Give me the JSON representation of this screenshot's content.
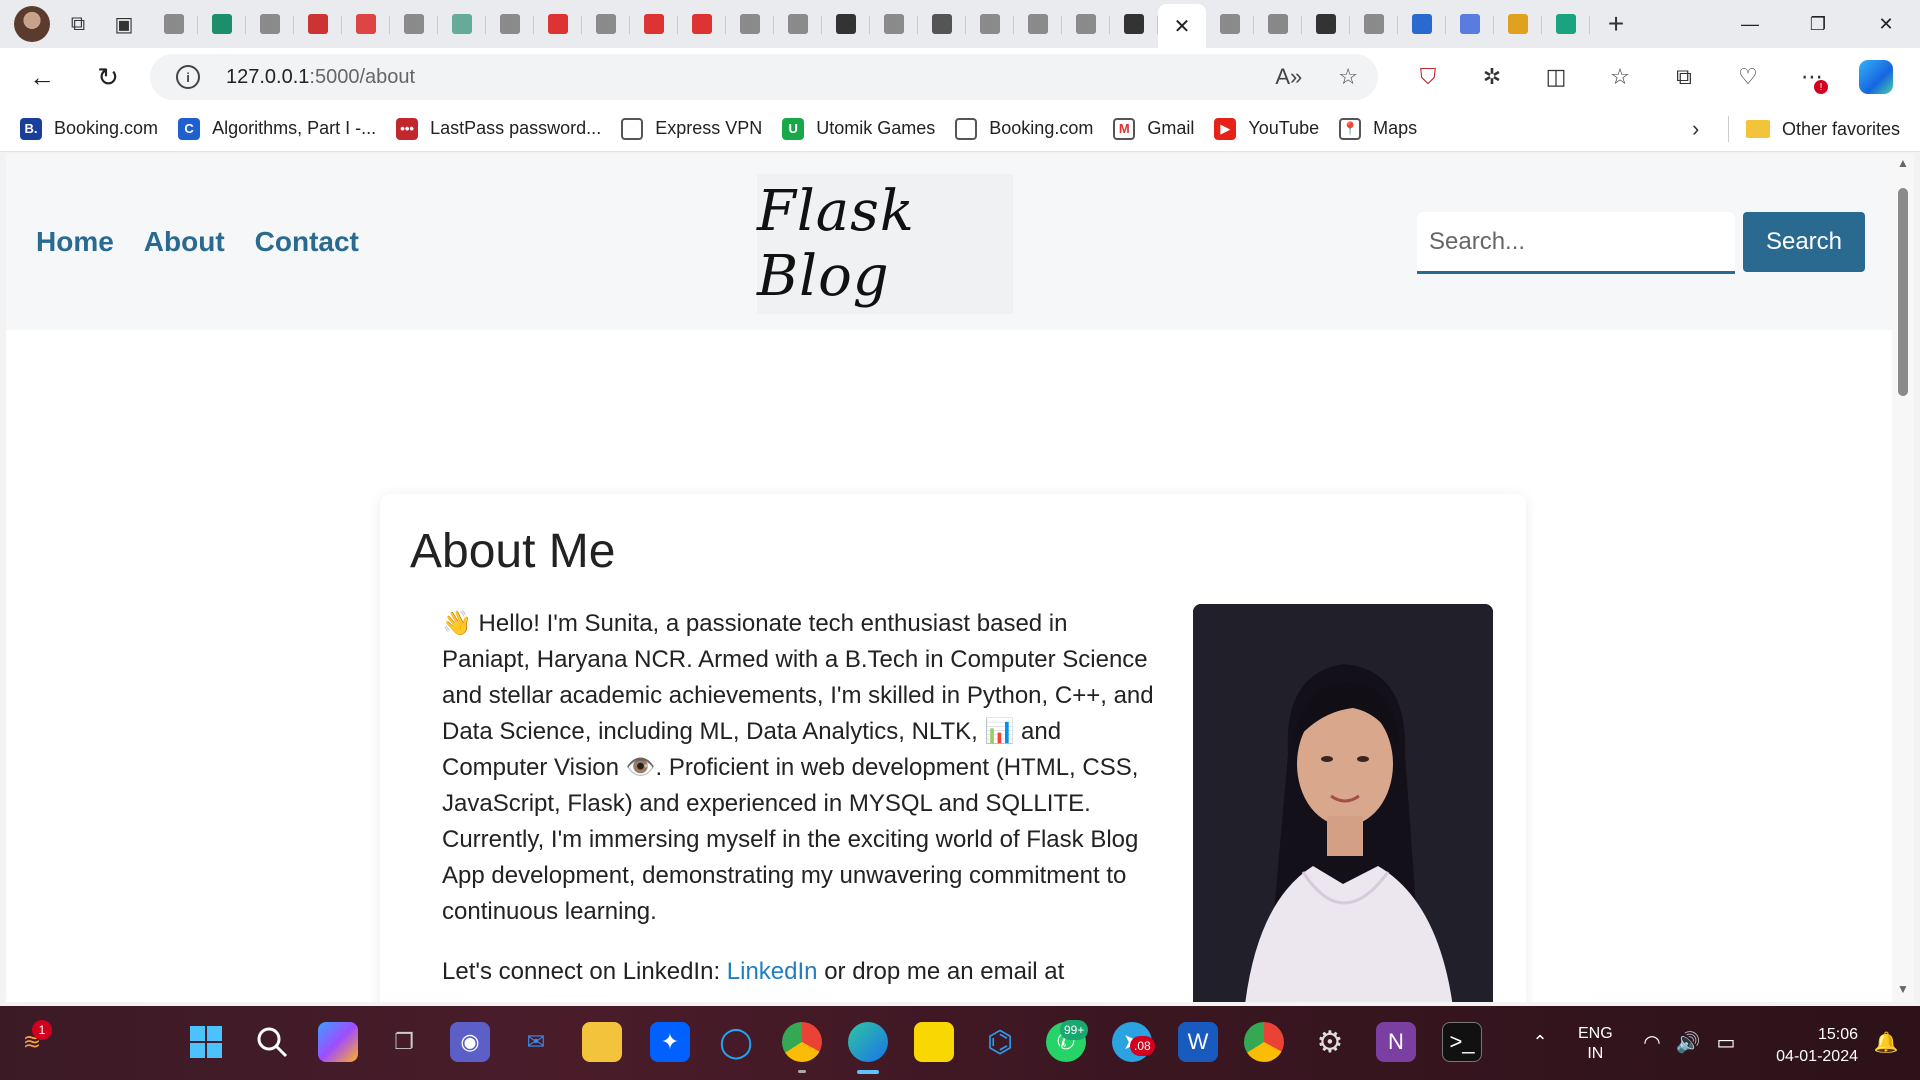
{
  "browser": {
    "tabs": [
      {
        "icon": "search-icon",
        "color": "#8a8a8a"
      },
      {
        "icon": "calendar-icon",
        "color": "#1b8f6a"
      },
      {
        "icon": "page-icon",
        "color": "#8a8a8a"
      },
      {
        "icon": "pdf-icon",
        "color": "#c33"
      },
      {
        "icon": "gmail-icon",
        "color": "#d44"
      },
      {
        "icon": "search-icon",
        "color": "#8a8a8a"
      },
      {
        "icon": "image-icon",
        "color": "#6a9"
      },
      {
        "icon": "page-icon",
        "color": "#8a8a8a"
      },
      {
        "icon": "shield-icon",
        "color": "#d33"
      },
      {
        "icon": "doc-icon",
        "color": "#8a8a8a"
      },
      {
        "icon": "shield-icon",
        "color": "#d33"
      },
      {
        "icon": "shield-icon",
        "color": "#d33"
      },
      {
        "icon": "doc-icon",
        "color": "#8a8a8a"
      },
      {
        "icon": "search-icon",
        "color": "#8a8a8a"
      },
      {
        "icon": "github-icon",
        "color": "#333"
      },
      {
        "icon": "doc-icon",
        "color": "#8a8a8a"
      },
      {
        "icon": "terminal-icon",
        "color": "#555"
      },
      {
        "icon": "search-icon",
        "color": "#8a8a8a"
      },
      {
        "icon": "page-icon",
        "color": "#8a8a8a"
      },
      {
        "icon": "search-icon",
        "color": "#8a8a8a"
      },
      {
        "icon": "github-icon",
        "color": "#333"
      },
      {
        "icon": "close-icon",
        "color": "#222",
        "active": true
      },
      {
        "icon": "search-icon",
        "color": "#8a8a8a"
      },
      {
        "icon": "dns-icon",
        "color": "#888"
      },
      {
        "icon": "page-icon",
        "color": "#333"
      },
      {
        "icon": "search-icon",
        "color": "#8a8a8a"
      },
      {
        "icon": "search-icon",
        "color": "#2a6ad0"
      },
      {
        "icon": "doc-icon",
        "color": "#5a7be0"
      },
      {
        "icon": "star-icon",
        "color": "#e0a020"
      },
      {
        "icon": "chatgpt-icon",
        "color": "#19a37f"
      }
    ],
    "close_glyph": "✕",
    "new_tab_glyph": "+",
    "url_host": "127.0.0.1",
    "url_path": ":5000/about",
    "info_glyph": "i",
    "favorites": [
      {
        "label": "Booking.com",
        "icon": "booking-icon",
        "color": "#1a3f9a",
        "glyph": "B."
      },
      {
        "label": "Algorithms, Part I -...",
        "icon": "coursera-icon",
        "color": "#1f5fd0",
        "glyph": "C"
      },
      {
        "label": "LastPass password...",
        "icon": "lastpass-icon",
        "color": "#c0282d",
        "glyph": "•••"
      },
      {
        "label": "Express VPN",
        "icon": "page-icon",
        "color": "#ffffff",
        "glyph": ""
      },
      {
        "label": "Utomik Games",
        "icon": "utomik-icon",
        "color": "#18a84a",
        "glyph": "U"
      },
      {
        "label": "Booking.com",
        "icon": "page-icon",
        "color": "#ffffff",
        "glyph": ""
      },
      {
        "label": "Gmail",
        "icon": "gmail-icon",
        "color": "#ffffff",
        "glyph": "M"
      },
      {
        "label": "YouTube",
        "icon": "youtube-icon",
        "color": "#e62117",
        "glyph": "▶"
      },
      {
        "label": "Maps",
        "icon": "maps-pin-icon",
        "color": "#ffffff",
        "glyph": "📍"
      }
    ],
    "other_favorites": "Other favorites",
    "chevron_glyph": "›"
  },
  "site": {
    "nav": [
      "Home",
      "About",
      "Contact"
    ],
    "logo": "Flask Blog",
    "search_placeholder": "Search...",
    "search_button": "Search"
  },
  "about": {
    "title": "About Me",
    "bio": "👋 Hello! I'm Sunita, a passionate tech enthusiast based in Paniapt, Haryana NCR. Armed with a B.Tech in Computer Science and stellar academic achievements, I'm skilled in Python, C++, and Data Science, including ML, Data Analytics, NLTK, 📊 and Computer Vision 👁️. Proficient in web development (HTML, CSS, JavaScript, Flask) and experienced in MYSQL and SQLLITE. Currently, I'm immersing myself in the exciting world of Flask Blog App development, demonstrating my unwavering commitment to continuous learning.",
    "connect_prefix": "Let's connect on LinkedIn: ",
    "linkedin_label": "LinkedIn",
    "connect_suffix": " or drop me an email at"
  },
  "taskbar": {
    "weather_badge": "1",
    "whatsapp_badge": "99+",
    "telegram_badge": ".08",
    "lang_line1": "ENG",
    "lang_line2": "IN",
    "time": "15:06",
    "date": "04-01-2024"
  }
}
